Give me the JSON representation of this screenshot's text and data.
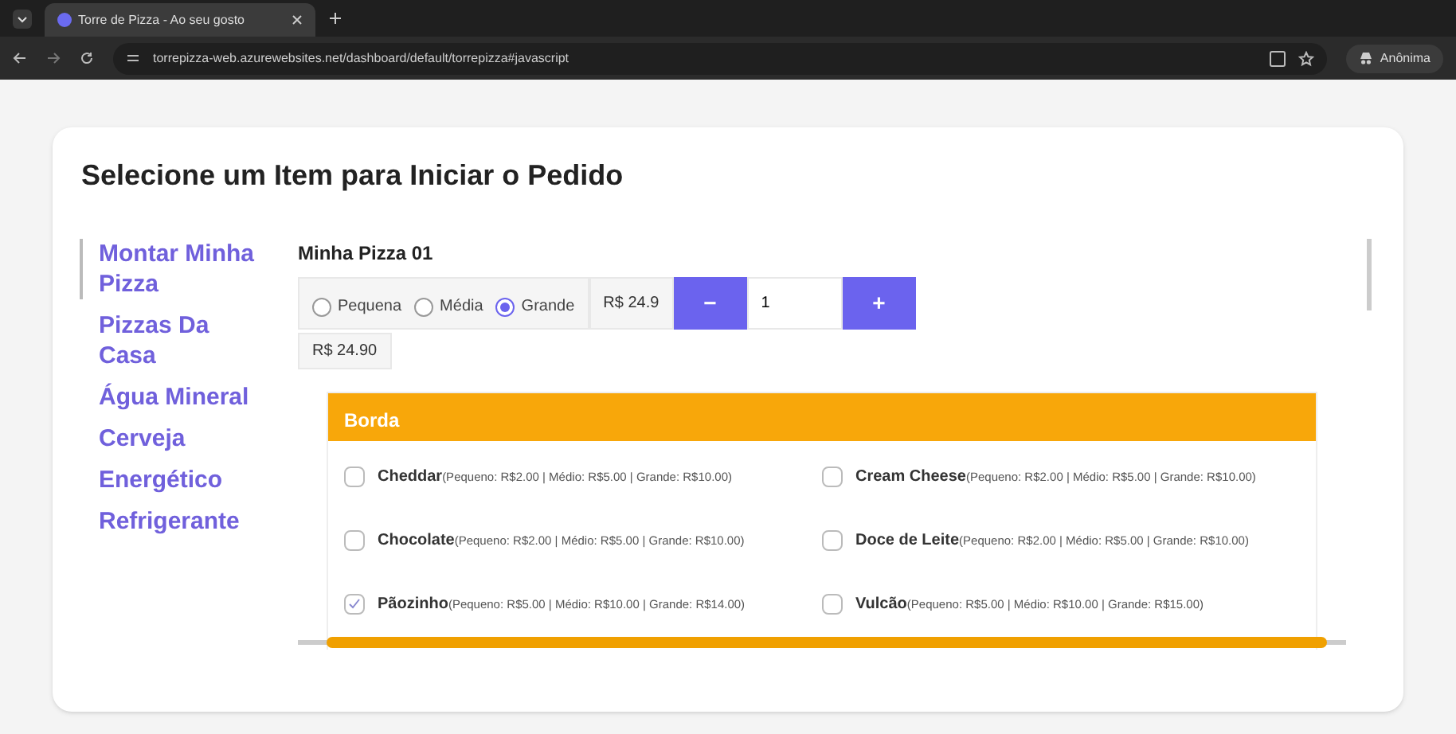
{
  "browser": {
    "tab_title": "Torre de Pizza - Ao seu gosto",
    "url": "torrepizza-web.azurewebsites.net/dashboard/default/torrepizza#javascript",
    "profile": "Anônima"
  },
  "page": {
    "title": "Selecione um Item para Iniciar o Pedido"
  },
  "sidebar": {
    "items": [
      {
        "label": "Montar Minha Pizza",
        "selected": true
      },
      {
        "label": "Pizzas Da Casa",
        "selected": false
      },
      {
        "label": "Água Mineral",
        "selected": false
      },
      {
        "label": "Cerveja",
        "selected": false
      },
      {
        "label": "Energético",
        "selected": false
      },
      {
        "label": "Refrigerante",
        "selected": false
      }
    ]
  },
  "pizza": {
    "name": "Minha Pizza 01",
    "sizes": [
      {
        "label": "Pequena",
        "selected": false
      },
      {
        "label": "Média",
        "selected": false
      },
      {
        "label": "Grande",
        "selected": true
      }
    ],
    "unit_price": "R$ 24.9",
    "decrement": "−",
    "quantity": "1",
    "increment": "+",
    "total": "R$ 24.90"
  },
  "section": {
    "title": "Borda",
    "options": [
      {
        "name": "Cheddar",
        "prices": "(Pequeno: R$2.00 | Médio: R$5.00 | Grande: R$10.00)",
        "checked": false
      },
      {
        "name": "Cream Cheese",
        "prices": "(Pequeno: R$2.00 | Médio: R$5.00 | Grande: R$10.00)",
        "checked": false
      },
      {
        "name": "Chocolate",
        "prices": "(Pequeno: R$2.00 | Médio: R$5.00 | Grande: R$10.00)",
        "checked": false
      },
      {
        "name": "Doce de Leite",
        "prices": "(Pequeno: R$2.00 | Médio: R$5.00 | Grande: R$10.00)",
        "checked": false
      },
      {
        "name": "Pãozinho",
        "prices": "(Pequeno: R$5.00 | Médio: R$10.00 | Grande: R$14.00)",
        "checked": true
      },
      {
        "name": "Vulcão",
        "prices": "(Pequeno: R$5.00 | Médio: R$10.00 | Grande: R$15.00)",
        "checked": false
      }
    ]
  }
}
